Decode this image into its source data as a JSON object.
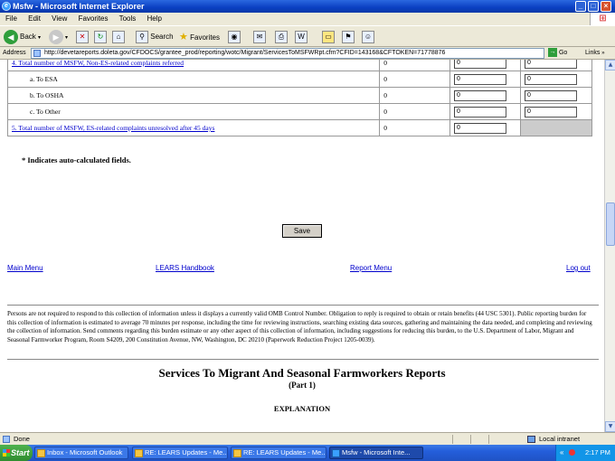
{
  "window": {
    "title": "Msfw - Microsoft Internet Explorer"
  },
  "menu": [
    "File",
    "Edit",
    "View",
    "Favorites",
    "Tools",
    "Help"
  ],
  "toolbar": {
    "back": "Back",
    "search": "Search",
    "favorites": "Favorites"
  },
  "address": {
    "label": "Address",
    "url": "http://devetareports.doleta.gov/CFDOCS/grantee_prod/reporting/wotc/Migrant/ServicesToMSFWRpt.cfm?CFID=143168&CFTOKEN=71778876",
    "go": "Go",
    "links": "Links"
  },
  "table": {
    "rows": [
      {
        "label": "4. Total number of MSFW, Non-ES-related complaints referred",
        "col1": "0",
        "col2": "0",
        "col3": "0",
        "link": true,
        "indent": false
      },
      {
        "label": "a. To ESA",
        "col1": "0",
        "col2": "0",
        "col3": "0",
        "link": false,
        "indent": true
      },
      {
        "label": "b. To OSHA",
        "col1": "0",
        "col2": "0",
        "col3": "0",
        "link": false,
        "indent": true
      },
      {
        "label": "c. To Other",
        "col1": "0",
        "col2": "0",
        "col3": "0",
        "link": false,
        "indent": true
      },
      {
        "label": "5. Total number of MSFW, ES-related complaints unresolved after 45 days",
        "col1": "0",
        "col2": "0",
        "col3": "",
        "link": true,
        "indent": false
      }
    ]
  },
  "note": "* Indicates auto-calculated fields.",
  "save_label": "Save",
  "nav": {
    "main_menu": "Main Menu",
    "handbook": "LEARS Handbook",
    "report_menu": "Report Menu",
    "logout": "Log out"
  },
  "disclaimer": "Persons are not required to respond to this collection of information unless it displays a currently valid OMB Control Number. Obligation to reply is required to obtain or retain benefits (44 USC 5301). Public reporting burden for this collection of information is estimated to average 70 minutes per response, including the time for reviewing instructions, searching existing data sources, gathering and maintaining the data needed, and completing and reviewing the collection of information. Send comments regarding this burden estimate or any other aspect of this collection of information, including suggestions for reducing this burden, to the U.S. Department of Labor, Migrant and Seasonal Farmworker Program, Room S4209, 200 Constitution Avenue, NW, Washington, DC 20210 (Paperwork Reduction Project 1205-0039).",
  "heading": {
    "title": "Services To Migrant And Seasonal Farmworkers Reports",
    "part": "(Part 1)",
    "explanation": "EXPLANATION"
  },
  "status": {
    "left": "Done",
    "zone": "Local intranet"
  },
  "taskbar": {
    "start": "Start",
    "tasks": [
      "Inbox - Microsoft Outlook",
      "RE: LEARS Updates - Me...",
      "RE: LEARS Updates - Me...",
      "Msfw - Microsoft Inte..."
    ],
    "clock": "2:17 PM"
  }
}
